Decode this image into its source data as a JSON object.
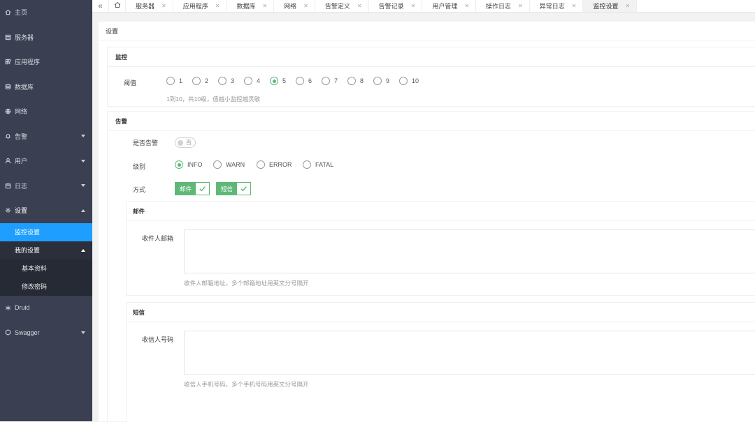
{
  "sidebar": {
    "items": [
      {
        "label": "主页",
        "icon": "home-icon"
      },
      {
        "label": "服务器",
        "icon": "server-icon"
      },
      {
        "label": "应用程序",
        "icon": "app-icon"
      },
      {
        "label": "数据库",
        "icon": "database-icon"
      },
      {
        "label": "网络",
        "icon": "globe-icon"
      },
      {
        "label": "告警",
        "icon": "bell-icon"
      },
      {
        "label": "用户",
        "icon": "user-icon"
      },
      {
        "label": "日志",
        "icon": "calendar-icon"
      },
      {
        "label": "设置",
        "icon": "gear-icon"
      }
    ],
    "settings_sub": {
      "monitor": "监控设置",
      "my_settings": "我的设置",
      "basic_info": "基本资料",
      "change_password": "修改密码"
    },
    "after": [
      {
        "label": "Druid",
        "icon": "snowflake-icon"
      },
      {
        "label": "Swagger",
        "icon": "swagger-icon"
      }
    ]
  },
  "tabs": {
    "back_icon": "«",
    "home_icon": "home-icon",
    "items": [
      "服务器",
      "应用程序",
      "数据库",
      "网络",
      "告警定义",
      "告警记录",
      "用户管理",
      "操作日志",
      "异常日志",
      "监控设置"
    ],
    "active_index": 9,
    "close_glyph": "✕"
  },
  "page": {
    "title": "设置",
    "monitor": {
      "title": "监控",
      "threshold_label": "阈值",
      "options": [
        "1",
        "2",
        "3",
        "4",
        "5",
        "6",
        "7",
        "8",
        "9",
        "10"
      ],
      "selected": "5",
      "hint": "1到10，共10级，值越小监控越灵敏"
    },
    "alarm": {
      "title": "告警",
      "enable_label": "是否告警",
      "enable_state": "否",
      "level_label": "级别",
      "levels": [
        "INFO",
        "WARN",
        "ERROR",
        "FATAL"
      ],
      "selected_level": "INFO",
      "method_label": "方式",
      "methods": [
        "邮件",
        "短信"
      ],
      "email": {
        "title": "邮件",
        "field_label": "收件人邮箱",
        "value": "",
        "hint": "收件人邮箱地址，多个邮箱地址用英文分号隔开"
      },
      "sms": {
        "title": "短信",
        "field_label": "收信人号码",
        "value": "",
        "hint": "收信人手机号码，多个手机号码用英文分号隔开"
      }
    }
  },
  "colors": {
    "sidebar_bg": "#3a3f51",
    "active_blue": "#1e9fff",
    "check_green": "#5fb878"
  }
}
